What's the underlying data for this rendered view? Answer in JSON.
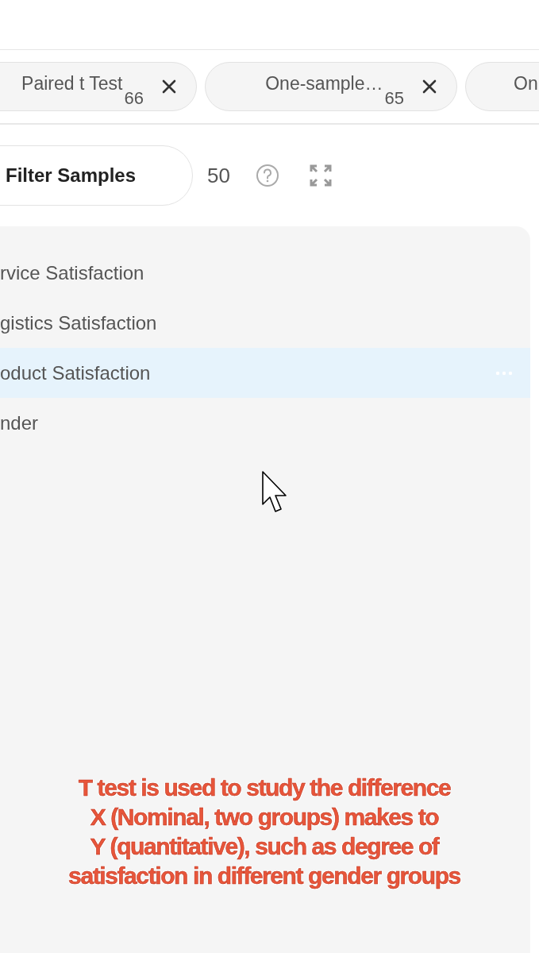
{
  "tabs": [
    {
      "label": "Paired t Test",
      "count": "66",
      "closable": true
    },
    {
      "label": "One-sample…",
      "count": "65",
      "closable": true
    },
    {
      "label": "On",
      "closable": false
    }
  ],
  "filter": {
    "label": "Filter Samples",
    "count": "50"
  },
  "variables": [
    {
      "name": "rvice Satisfaction",
      "selected": false
    },
    {
      "name": "gistics Satisfaction",
      "selected": false
    },
    {
      "name": "oduct Satisfaction",
      "selected": true
    },
    {
      "name": "nder",
      "selected": false
    }
  ],
  "caption": [
    "T test is used to study the difference",
    "X (Nominal, two groups) makes to",
    "Y (quantitative), such as degree of",
    "satisfaction in different gender groups"
  ]
}
